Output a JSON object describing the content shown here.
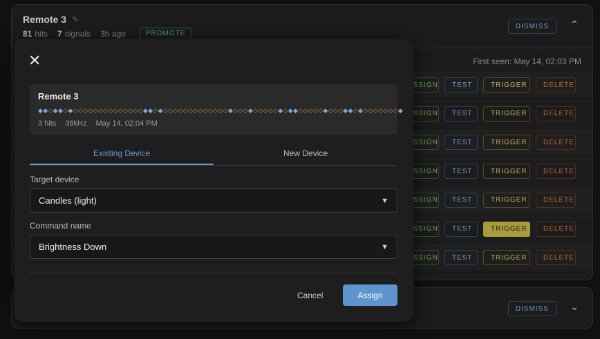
{
  "background_card": {
    "title": "Remote 3",
    "edit_icon": "pencil-icon",
    "hits_count": "81",
    "hits_label": "hits",
    "signals_count": "7",
    "signals_label": "signals",
    "age": "3h ago",
    "promote_label": "PROMOTE",
    "dismiss_label": "DISMISS",
    "collapse_icon": "chevron-up-icon",
    "first_seen": "First seen: May 14, 02:03 PM",
    "row_buttons": {
      "assign": "ASSIGN",
      "test": "TEST",
      "trigger": "TRIGGER",
      "delete": "DELETE"
    },
    "row_count": 7,
    "active_trigger_row": 6
  },
  "second_card": {
    "dismiss_label": "DISMISS",
    "expand_icon": "chevron-down-icon"
  },
  "modal": {
    "close_icon": "close-icon",
    "signal": {
      "name": "Remote 3",
      "pattern": "1101101000000000000001101000000000000010001000001011000001000110100000001",
      "hits": "3 hits",
      "frequency": "38kHz",
      "timestamp": "May 14, 02:04 PM"
    },
    "tabs": [
      {
        "label": "Existing Device",
        "active": true
      },
      {
        "label": "New Device",
        "active": false
      }
    ],
    "target_device": {
      "label": "Target device",
      "value": "Candles (light)"
    },
    "command_name": {
      "label": "Command name",
      "value": "Brightness Down"
    },
    "cancel_label": "Cancel",
    "assign_label": "Assign"
  },
  "colors": {
    "accent_blue": "#6a9bd1",
    "assign_green": "#6aa24f",
    "trigger_yellow": "#c2b14c",
    "delete_orange": "#c8602f",
    "primary_button": "#5f95cf"
  }
}
